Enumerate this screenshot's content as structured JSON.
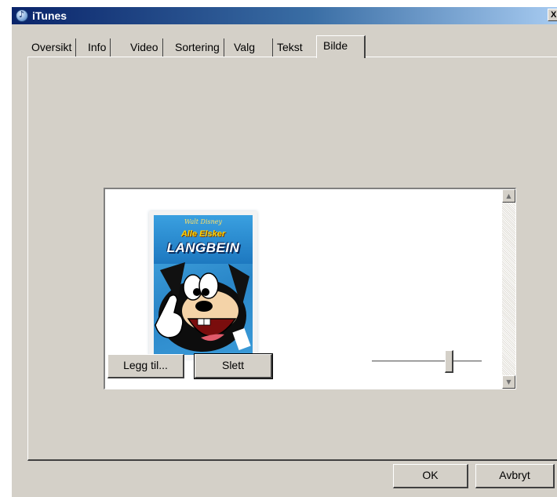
{
  "window": {
    "title": "iTunes",
    "close_label": "X"
  },
  "tabs": [
    {
      "label": "Oversikt"
    },
    {
      "label": "Info"
    },
    {
      "label": "Video"
    },
    {
      "label": "Sortering"
    },
    {
      "label": "Valg"
    },
    {
      "label": "Tekst"
    },
    {
      "label": "Bilde",
      "active": true
    }
  ],
  "artwork": {
    "cover_brand": "Walt Disney",
    "cover_subtitle": "Alle Elsker",
    "cover_title": "LANGBEIN"
  },
  "buttons": {
    "add": "Legg til...",
    "delete": "Slett",
    "ok": "OK",
    "cancel": "Avbryt"
  },
  "zoom_slider": {
    "level": 0.72
  },
  "colors": {
    "titlebar_start": "#0a246a",
    "titlebar_end": "#a6caf0",
    "face": "#d4d0c8"
  }
}
